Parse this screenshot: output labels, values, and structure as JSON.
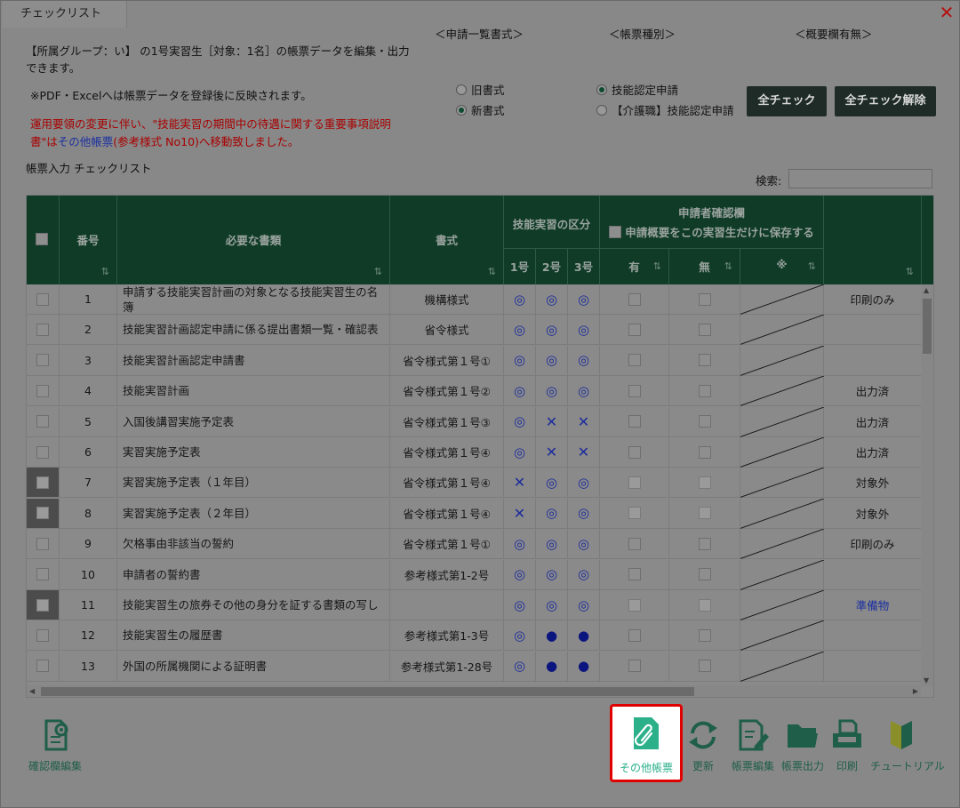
{
  "window": {
    "title": "チェックリスト",
    "close_label": "✕"
  },
  "info": {
    "line1": "【所属グループ：い】 の1号実習生［対象：1名］の帳票データを編集・出力",
    "line2": "できます。",
    "note": "※PDF・Excelへは帳票データを登録後に反映されます。",
    "notice_line1": "運用要領の変更に伴い、\"技能実習の期間中の待遇に関する重要事項説明",
    "notice_line2_a": "書\"は",
    "notice_line2_link": "その他帳票",
    "notice_line2_b": "(参考様式 No10)へ移動致しました。",
    "section_title": "帳票入力 チェックリスト"
  },
  "groups": {
    "ichiran_title": "＜申請一覧書式＞",
    "chouhyou_title": "＜帳票種別＞",
    "gaiyou_title": "＜概要欄有無＞",
    "format_options": [
      {
        "label": "旧書式",
        "checked": false
      },
      {
        "label": "新書式",
        "checked": true
      }
    ],
    "type_options": [
      {
        "label": "技能認定申請",
        "checked": true
      },
      {
        "label": "【介護職】技能認定申請",
        "checked": false
      }
    ]
  },
  "buttons": {
    "check_all": "全チェック",
    "uncheck_all": "全チェック解除"
  },
  "search": {
    "label": "検索:",
    "value": ""
  },
  "table": {
    "headers": {
      "number": "番号",
      "doc": "必要な書類",
      "format": "書式",
      "category": "技能実習の区分",
      "cat1": "1号",
      "cat2": "2号",
      "cat3": "3号",
      "confirm": "申請者確認欄",
      "confirm_sub": "申請概要をこの実習生だけに保存する",
      "yes": "有",
      "no": "無",
      "note": "※",
      "sort": "⇅"
    },
    "rows": [
      {
        "no": "1",
        "doc": "申請する技能実習計画の対象となる技能実習生の名簿",
        "format": "機構様式",
        "c1": "◎",
        "c2": "◎",
        "c3": "◎",
        "status": "印刷のみ",
        "selected": false,
        "link": false
      },
      {
        "no": "2",
        "doc": "技能実習計画認定申請に係る提出書類一覧・確認表",
        "format": "省令様式",
        "c1": "◎",
        "c2": "◎",
        "c3": "◎",
        "status": "",
        "selected": false,
        "link": false
      },
      {
        "no": "3",
        "doc": "技能実習計画認定申請書",
        "format": "省令様式第１号①",
        "c1": "◎",
        "c2": "◎",
        "c3": "◎",
        "status": "",
        "selected": false,
        "link": false
      },
      {
        "no": "4",
        "doc": "技能実習計画",
        "format": "省令様式第１号②",
        "c1": "◎",
        "c2": "◎",
        "c3": "◎",
        "status": "出力済",
        "selected": false,
        "link": false
      },
      {
        "no": "5",
        "doc": "入国後講習実施予定表",
        "format": "省令様式第１号③",
        "c1": "◎",
        "c2": "✕",
        "c3": "✕",
        "status": "出力済",
        "selected": false,
        "link": false
      },
      {
        "no": "6",
        "doc": "実習実施予定表",
        "format": "省令様式第１号④",
        "c1": "◎",
        "c2": "✕",
        "c3": "✕",
        "status": "出力済",
        "selected": false,
        "link": false
      },
      {
        "no": "7",
        "doc": "実習実施予定表（１年目）",
        "format": "省令様式第１号④",
        "c1": "✕",
        "c2": "◎",
        "c3": "◎",
        "status": "対象外",
        "selected": true,
        "link": false
      },
      {
        "no": "8",
        "doc": "実習実施予定表（２年目）",
        "format": "省令様式第１号④",
        "c1": "✕",
        "c2": "◎",
        "c3": "◎",
        "status": "対象外",
        "selected": true,
        "link": false
      },
      {
        "no": "9",
        "doc": "欠格事由非該当の誓約",
        "format": "省令様式第１号①",
        "c1": "◎",
        "c2": "◎",
        "c3": "◎",
        "status": "印刷のみ",
        "selected": false,
        "link": false
      },
      {
        "no": "10",
        "doc": "申請者の誓約書",
        "format": "参考様式第1-2号",
        "c1": "◎",
        "c2": "◎",
        "c3": "◎",
        "status": "",
        "selected": false,
        "link": false
      },
      {
        "no": "11",
        "doc": "技能実習生の旅券その他の身分を証する書類の写し",
        "format": "",
        "c1": "◎",
        "c2": "◎",
        "c3": "◎",
        "status": "準備物",
        "selected": true,
        "link": true
      },
      {
        "no": "12",
        "doc": "技能実習生の履歴書",
        "format": "参考様式第1-3号",
        "c1": "◎",
        "c2": "●",
        "c3": "●",
        "status": "",
        "selected": false,
        "link": false
      },
      {
        "no": "13",
        "doc": "外国の所属機関による証明書",
        "format": "参考様式第1-28号",
        "c1": "◎",
        "c2": "●",
        "c3": "●",
        "status": "",
        "selected": false,
        "link": false
      }
    ]
  },
  "toolbar": {
    "confirm_edit": "確認欄編集",
    "other_forms": "その他帳票",
    "refresh": "更新",
    "form_edit": "帳票編集",
    "form_output": "帳票出力",
    "print": "印刷",
    "tutorial": "チュートリアル"
  },
  "colors": {
    "header_green": "#0f3b27",
    "accent_teal": "#2bb08a",
    "highlight_red": "#e00000",
    "mark_blue": "#1b2b9c"
  }
}
